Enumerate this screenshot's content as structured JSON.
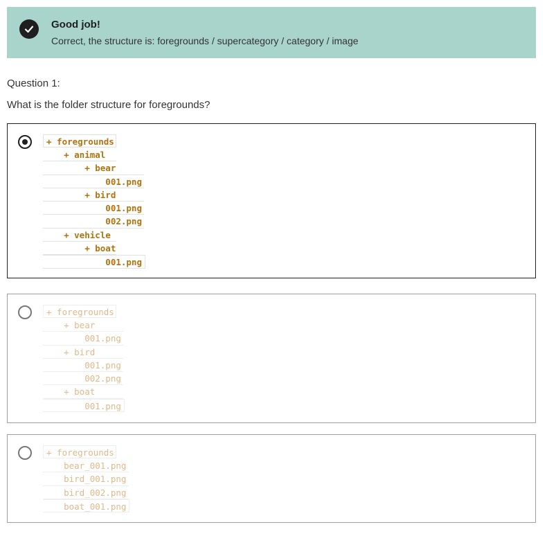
{
  "feedback": {
    "title": "Good job!",
    "message": "Correct, the structure is: foregrounds / supercategory / category / image"
  },
  "question": {
    "label": "Question 1:",
    "text": "What is the folder structure for foregrounds?"
  },
  "options": [
    {
      "selected": true,
      "lines": [
        "+ foregrounds",
        "    + animal",
        "        + bear",
        "            001.png",
        "        + bird",
        "            001.png",
        "            002.png",
        "    + vehicle",
        "        + boat",
        "            001.png"
      ]
    },
    {
      "selected": false,
      "lines": [
        "+ foregrounds",
        "    + bear",
        "        001.png",
        "    + bird",
        "        001.png",
        "        002.png",
        "    + boat",
        "        001.png"
      ]
    },
    {
      "selected": false,
      "lines": [
        "+ foregrounds",
        "    bear_001.png",
        "    bird_001.png",
        "    bird_002.png",
        "    boat_001.png"
      ]
    }
  ],
  "colors": {
    "banner_bg": "#a8d4cb",
    "code_text": "#b0730f",
    "code_text_dim": "#e0b98a"
  }
}
